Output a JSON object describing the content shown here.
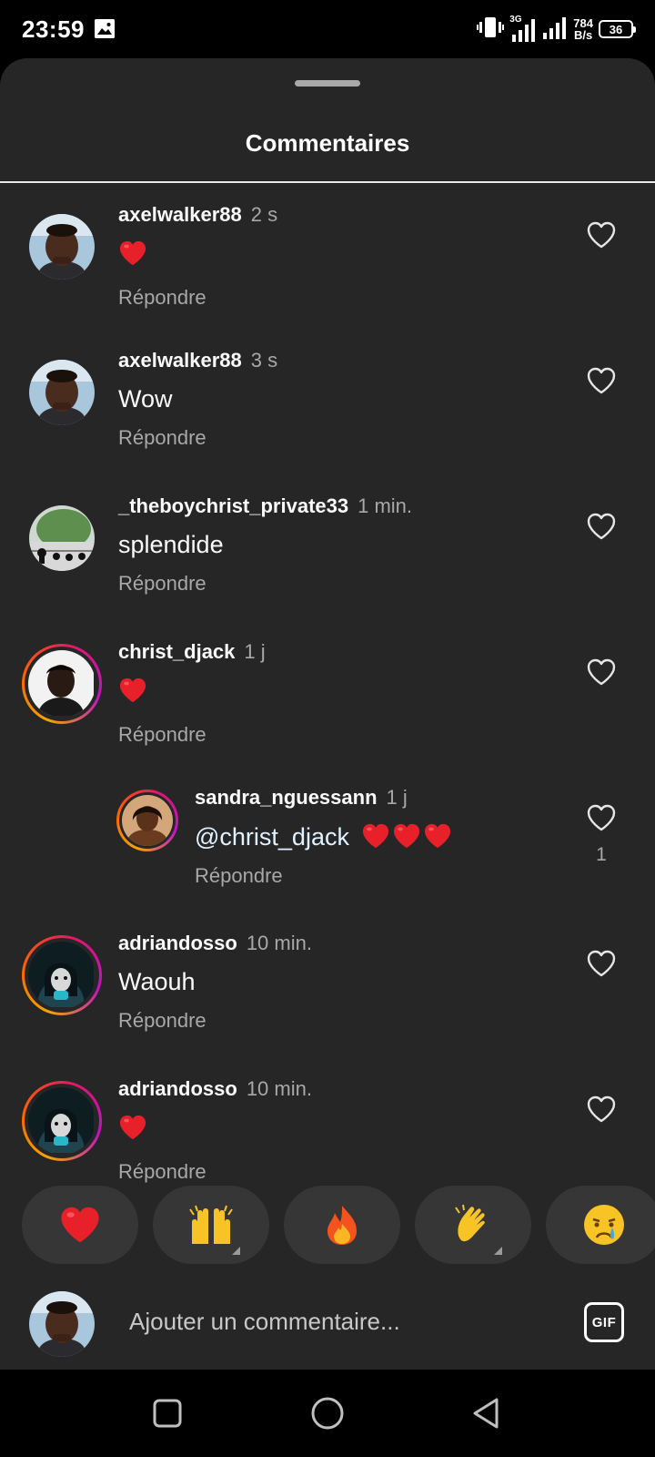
{
  "status_bar": {
    "time": "23:59",
    "net_speed_value": "784",
    "net_speed_unit": "B/s",
    "network_type": "3G",
    "battery": "36"
  },
  "sheet": {
    "title": "Commentaires"
  },
  "comments": [
    {
      "username": "axelwalker88",
      "time": "2 s",
      "text": "",
      "emojis": "❤️",
      "reply_label": "Répondre"
    },
    {
      "username": "axelwalker88",
      "time": "3 s",
      "text": "Wow",
      "reply_label": "Répondre"
    },
    {
      "username": "_theboychrist_private33",
      "time": "1 min.",
      "text": "splendide",
      "reply_label": "Répondre"
    },
    {
      "username": "christ_djack",
      "time": "1 j",
      "text": "",
      "emojis": "❤️",
      "reply_label": "Répondre"
    },
    {
      "username": "sandra_nguessann",
      "time": "1 j",
      "mention": "@christ_djack",
      "emojis": "❤️❤️❤️",
      "reply_label": "Répondre",
      "like_count": "1"
    },
    {
      "username": "adriandosso",
      "time": "10 min.",
      "text": "Waouh",
      "reply_label": "Répondre"
    },
    {
      "username": "adriandosso",
      "time": "10 min.",
      "text": "",
      "emojis": "❤️",
      "reply_label": "Répondre"
    }
  ],
  "emoji_bar": [
    "heart-emoji",
    "raised-hands-emoji",
    "fire-emoji",
    "clapping-hands-emoji",
    "crying-face-emoji"
  ],
  "composer": {
    "placeholder": "Ajouter un commentaire...",
    "gif_label": "GIF"
  },
  "colors": {
    "sheet_bg": "#262626",
    "heart_red": "#e8202a",
    "story_ring_start": "#f7a400",
    "story_ring_end": "#c013c9"
  }
}
